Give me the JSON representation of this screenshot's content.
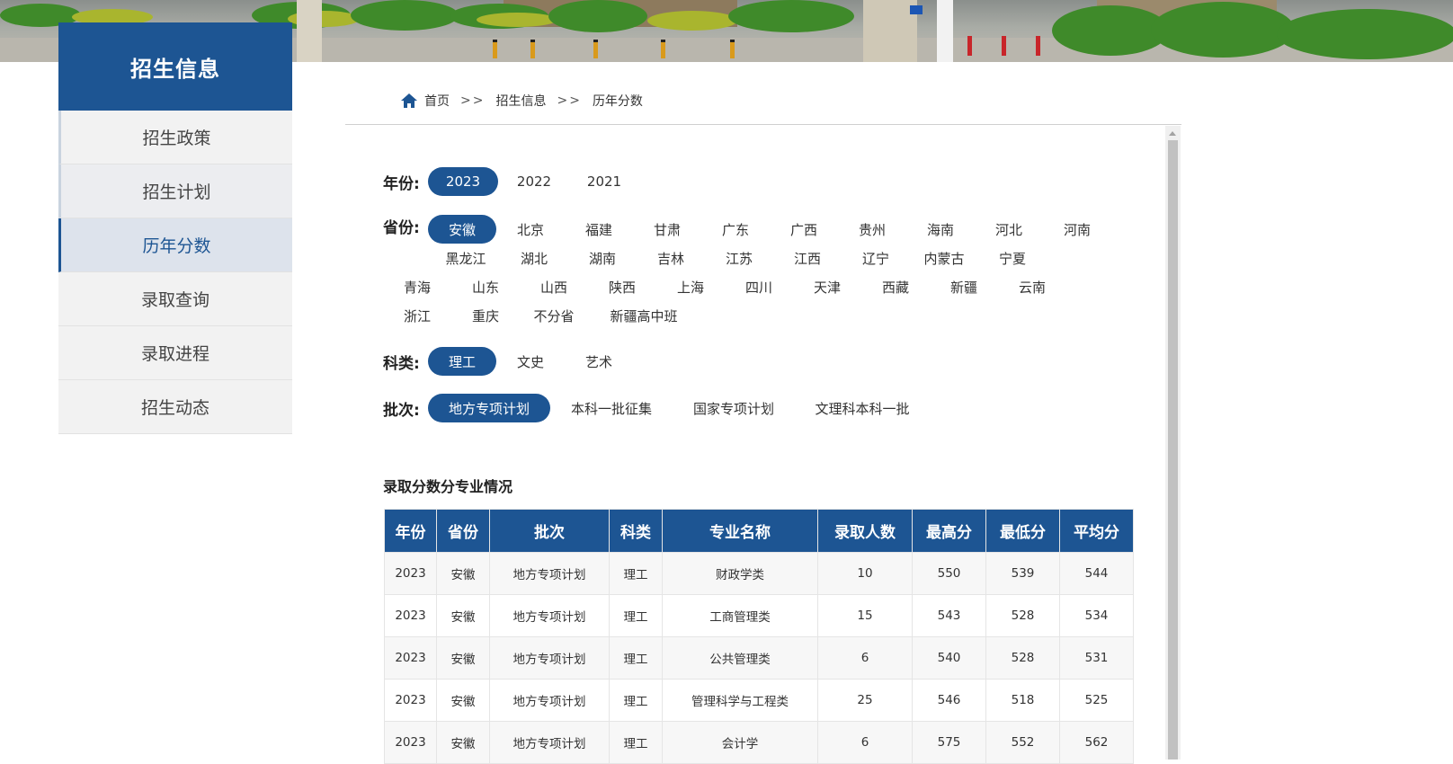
{
  "sidebar": {
    "title": "招生信息",
    "items": [
      {
        "label": "招生政策"
      },
      {
        "label": "招生计划"
      },
      {
        "label": "历年分数"
      },
      {
        "label": "录取查询"
      },
      {
        "label": "录取进程"
      },
      {
        "label": "招生动态"
      }
    ]
  },
  "breadcrumb": {
    "home": "首页",
    "sep": ">>",
    "level1": "招生信息",
    "level2": "历年分数"
  },
  "filters": {
    "year": {
      "label": "年份:",
      "options": [
        "2023",
        "2022",
        "2021"
      ]
    },
    "province": {
      "label": "省份:",
      "options": [
        "安徽",
        "北京",
        "福建",
        "甘肃",
        "广东",
        "广西",
        "贵州",
        "海南",
        "河北",
        "河南",
        "黑龙江",
        "湖北",
        "湖南",
        "吉林",
        "江苏",
        "江西",
        "辽宁",
        "内蒙古",
        "宁夏",
        "青海",
        "山东",
        "山西",
        "陕西",
        "上海",
        "四川",
        "天津",
        "西藏",
        "新疆",
        "云南",
        "浙江",
        "重庆",
        "不分省",
        "新疆高中班"
      ]
    },
    "subject": {
      "label": "科类:",
      "options": [
        "理工",
        "文史",
        "艺术"
      ]
    },
    "batch": {
      "label": "批次:",
      "options": [
        "地方专项计划",
        "本科一批征集",
        "国家专项计划",
        "文理科本科一批"
      ]
    }
  },
  "table": {
    "title": "录取分数分专业情况",
    "headers": [
      "年份",
      "省份",
      "批次",
      "科类",
      "专业名称",
      "录取人数",
      "最高分",
      "最低分",
      "平均分"
    ],
    "rows": [
      [
        "2023",
        "安徽",
        "地方专项计划",
        "理工",
        "财政学类",
        "10",
        "550",
        "539",
        "544"
      ],
      [
        "2023",
        "安徽",
        "地方专项计划",
        "理工",
        "工商管理类",
        "15",
        "543",
        "528",
        "534"
      ],
      [
        "2023",
        "安徽",
        "地方专项计划",
        "理工",
        "公共管理类",
        "6",
        "540",
        "528",
        "531"
      ],
      [
        "2023",
        "安徽",
        "地方专项计划",
        "理工",
        "管理科学与工程类",
        "25",
        "546",
        "518",
        "525"
      ],
      [
        "2023",
        "安徽",
        "地方专项计划",
        "理工",
        "会计学",
        "6",
        "575",
        "552",
        "562"
      ]
    ]
  },
  "colors": {
    "primary": "#1d5593",
    "sidebar_bg": "#f2f2f2",
    "active_bg": "#dde3ec"
  }
}
